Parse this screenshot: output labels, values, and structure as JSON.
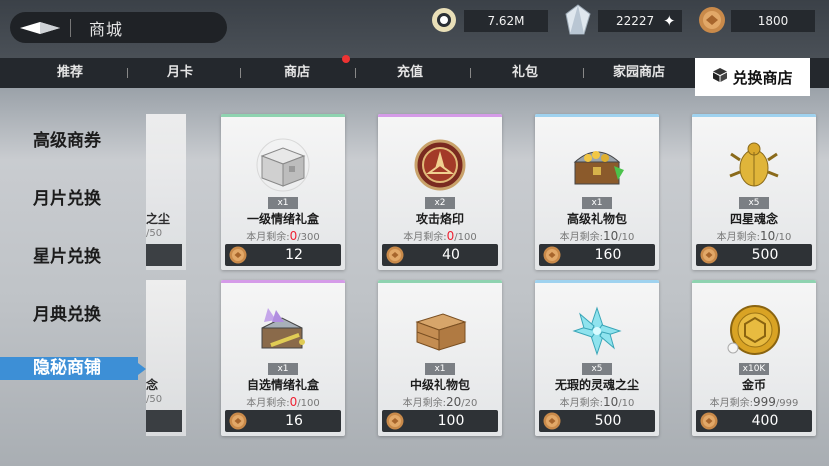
{
  "header": {
    "title": "商城",
    "currencies": [
      {
        "icon": "ring-gem-icon",
        "value": "7.62M"
      },
      {
        "icon": "crystal-icon",
        "value": "22227"
      },
      {
        "icon": "gold-coin-icon",
        "value": "1800"
      }
    ]
  },
  "tabs": [
    {
      "label": "推荐"
    },
    {
      "label": "月卡"
    },
    {
      "label": "商店"
    },
    {
      "label": "充值"
    },
    {
      "label": "礼包"
    },
    {
      "label": "家园商店"
    }
  ],
  "active_tab": {
    "label": "兑换商店",
    "icon": "cube-icon"
  },
  "sidebar": {
    "items": [
      {
        "label": "高级商券"
      },
      {
        "label": "月片兑换"
      },
      {
        "label": "星片兑换"
      },
      {
        "label": "月典兑换"
      }
    ],
    "active": {
      "label": "隐秘商铺"
    }
  },
  "limit_prefix": "本月剩余:",
  "ghost_cards": [
    {
      "name_fragment": "之尘",
      "limit_fragment": "/50"
    },
    {
      "name_fragment": "念",
      "limit_fragment": "/50"
    }
  ],
  "cards": [
    {
      "name": "一级情绪礼盒",
      "qty": "x1",
      "remain": "0",
      "total": "/300",
      "price": "12",
      "icon": "silver-chest-icon",
      "accent": "#8fd3b0"
    },
    {
      "name": "攻击烙印",
      "qty": "x2",
      "remain": "0",
      "total": "/100",
      "price": "40",
      "icon": "attack-emblem-icon",
      "accent": "#d59be8"
    },
    {
      "name": "高级礼物包",
      "qty": "x1",
      "remain": "10",
      "total": "/10",
      "price": "160",
      "icon": "treasure-chest-icon",
      "accent": "#9fd2ef"
    },
    {
      "name": "四星魂念",
      "qty": "x5",
      "remain": "10",
      "total": "/10",
      "price": "500",
      "icon": "golden-beetle-icon",
      "accent": "#9fd2ef"
    },
    {
      "name": "自选情绪礼盒",
      "qty": "x1",
      "remain": "0",
      "total": "/100",
      "price": "16",
      "icon": "crystal-chest-icon",
      "accent": "#d59be8"
    },
    {
      "name": "中级礼物包",
      "qty": "x1",
      "remain": "20",
      "total": "/20",
      "price": "100",
      "icon": "wooden-box-icon",
      "accent": "#8fd3b0"
    },
    {
      "name": "无瑕的灵魂之尘",
      "qty": "x5",
      "remain": "10",
      "total": "/10",
      "price": "500",
      "icon": "soul-crystal-icon",
      "accent": "#9fd2ef"
    },
    {
      "name": "金币",
      "qty": "x10K",
      "remain": "999",
      "total": "/999",
      "price": "400",
      "icon": "gold-medal-icon",
      "accent": "#8fd3b0"
    }
  ]
}
